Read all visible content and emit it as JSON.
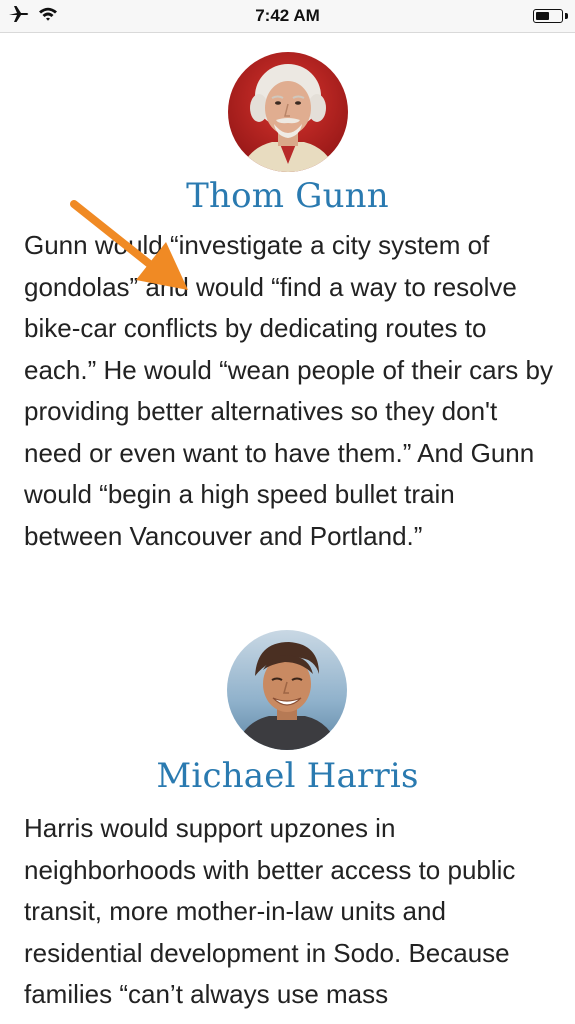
{
  "status_bar": {
    "time": "7:42 AM",
    "icons": [
      "airplane-mode-icon",
      "wifi-icon",
      "battery-icon"
    ],
    "battery_level": 0.55
  },
  "colors": {
    "name_link": "#2a7ab0",
    "body_text": "#222222",
    "annotation_arrow": "#f08a24"
  },
  "candidates": [
    {
      "name": "Thom Gunn",
      "bio": "Gunn would “investigate a city system of gondolas” and would “find a way to resolve bike-car conflicts by dedicating routes to each.” He would “wean people of their cars by providing better alternatives so they don't need or even want to have them.” And Gunn would “begin a high speed bullet train between Vancouver and Portland.”"
    },
    {
      "name": "Michael Harris",
      "bio": "Harris would support upzones in neighborhoods with better access to public transit, more mother-in-law units and residential development in Sodo. Because families “can’t always use mass"
    }
  ]
}
